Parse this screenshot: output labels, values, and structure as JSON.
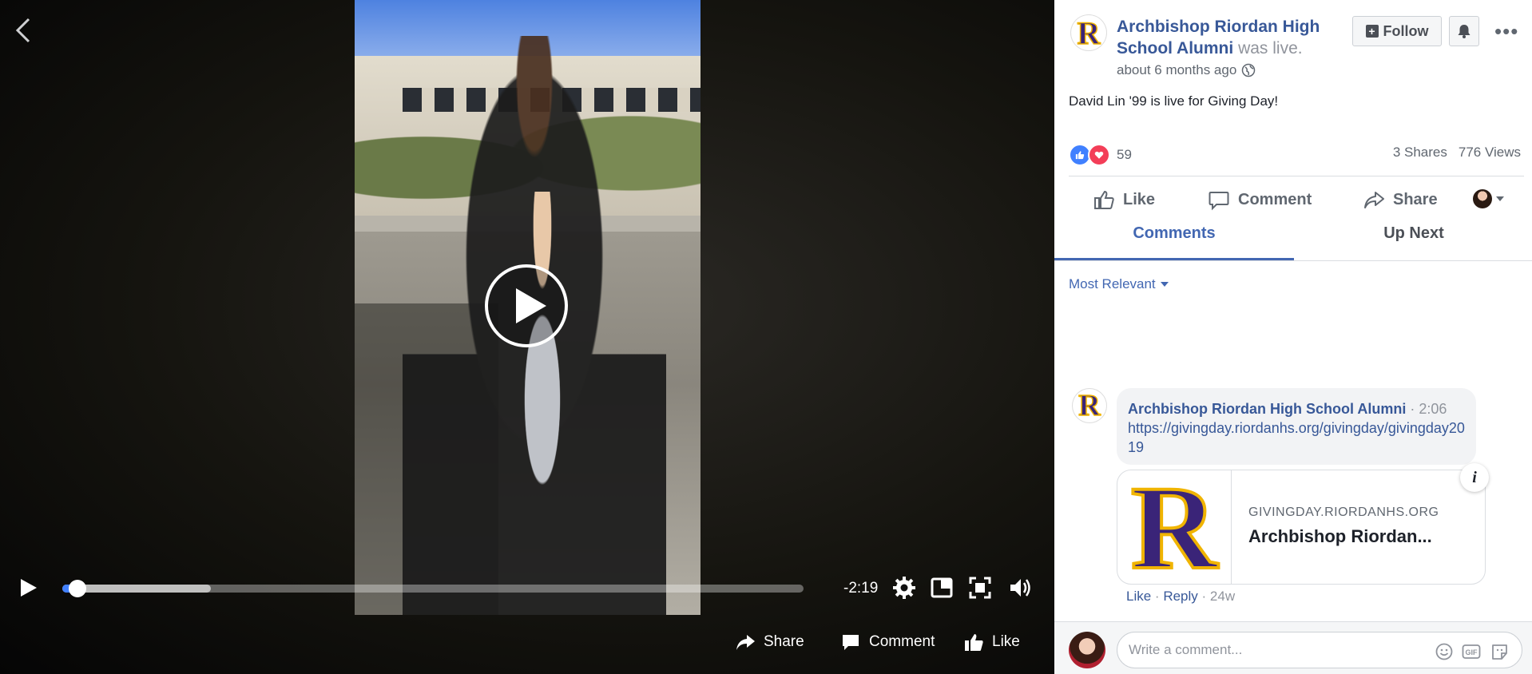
{
  "video": {
    "time_remaining": "-2:19",
    "progress_fraction": 0.02,
    "buffered_fraction": 0.2,
    "share_label": "Share",
    "comment_label": "Comment",
    "like_label": "Like"
  },
  "post": {
    "page_name": "Archbishop Riordan High School Alumni",
    "live_suffix": "was live.",
    "time_ago": "about 6 months ago",
    "follow_label": "Follow",
    "text": "David Lin '99 is live for Giving Day!",
    "reaction_count": "59",
    "shares": "3 Shares",
    "views": "776 Views",
    "like_label": "Like",
    "comment_label": "Comment",
    "share_label": "Share"
  },
  "tabs": [
    {
      "label": "Comments"
    },
    {
      "label": "Up Next"
    }
  ],
  "sort_label": "Most Relevant",
  "comment": {
    "author": "Archbishop Riordan High School Alumni",
    "time": "2:06",
    "link_text": "https://givingday.riordanhs.org/givingday/givingday2019",
    "card_domain": "GIVINGDAY.RIORDANHS.ORG",
    "card_title": "Archbishop Riordan...",
    "like_label": "Like",
    "reply_label": "Reply",
    "age": "24w"
  },
  "logo_letter": "R",
  "composer": {
    "placeholder": "Write a comment..."
  },
  "colors": {
    "link_blue": "#385898",
    "accent_blue": "#4267b2",
    "progress_blue": "#4080ff",
    "logo_purple": "#3a2478",
    "logo_gold": "#f0b400"
  },
  "icons": [
    "back-icon",
    "play-icon",
    "settings-icon",
    "mini-player-icon",
    "fullscreen-icon",
    "volume-icon",
    "share-icon",
    "comment-icon",
    "like-icon",
    "globe-icon",
    "bell-icon",
    "more-icon",
    "heart-icon",
    "chevron-down-icon",
    "info-icon",
    "emoji-icon",
    "gif-icon",
    "sticker-icon"
  ]
}
